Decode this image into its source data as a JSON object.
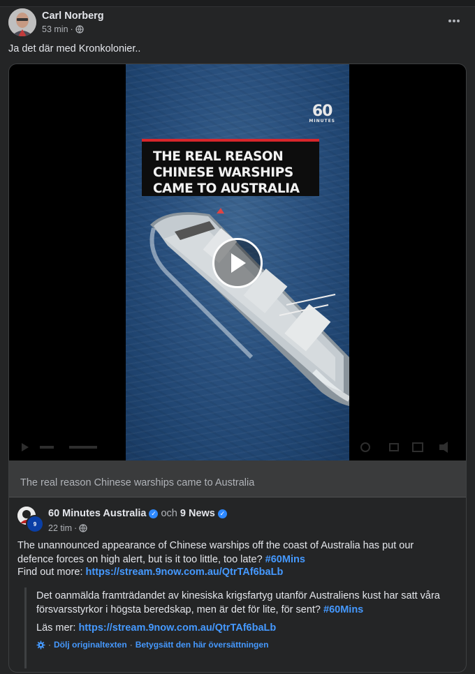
{
  "post": {
    "author": "Carl Norberg",
    "time": "53 min",
    "dot": "·",
    "text": "Ja det där med Kronkolonier.."
  },
  "video": {
    "logo_big": "60",
    "logo_small": "MINUTES",
    "headline_line1": "THE REAL REASON",
    "headline_line2": "CHINESE WARSHIPS",
    "headline_line3": "CAME TO AUSTRALIA"
  },
  "link_title": "The real reason Chinese warships came to Australia",
  "shared": {
    "page1": "60 Minutes Australia",
    "joiner": "och",
    "page2": "9 News",
    "badge": "9",
    "time": "22 tim",
    "dot": "·",
    "body": "The unannounced appearance of Chinese warships off the coast of Australia has put our defence forces on high alert, but is it too little, too late?",
    "hashtag": "#60Mins",
    "find_label": "Find out more:",
    "url": "https://stream.9now.com.au/QtrTAf6baLb"
  },
  "translation": {
    "body": "Det oanmälda framträdandet av kinesiska krigsfartyg utanför Australiens kust har satt våra försvarsstyrkor i högsta beredskap, men är det för lite, för sent?",
    "hashtag": "#60Mins",
    "find_label": "Läs mer:",
    "url": "https://stream.9now.com.au/QtrTAf6baLb",
    "hide_original": "Dölj originaltexten",
    "rate": "Betygsätt den här översättningen",
    "sep": "·"
  },
  "colors": {
    "background": "#242526",
    "link": "#4599ff",
    "verified": "#2d88ff",
    "headline_red": "#d8262b"
  }
}
